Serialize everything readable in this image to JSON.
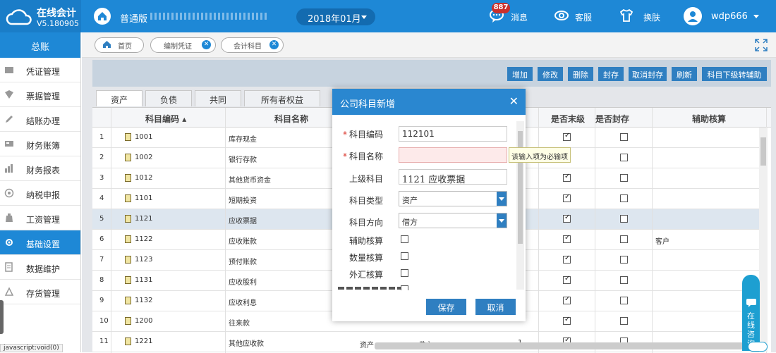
{
  "app": {
    "name": "在线会计",
    "version": "V5.180905"
  },
  "topbar": {
    "edition": "普通版",
    "period": "2018年01月",
    "messages_label": "消息",
    "messages_badge": "887",
    "service_label": "客服",
    "skin_label": "换肤",
    "username": "wdp666"
  },
  "sidebar": {
    "title": "总账",
    "items": [
      {
        "label": "凭证管理",
        "icon": "voucher-icon"
      },
      {
        "label": "票据管理",
        "icon": "invoice-icon"
      },
      {
        "label": "结账办理",
        "icon": "pencil-icon"
      },
      {
        "label": "财务账簿",
        "icon": "ledger-icon"
      },
      {
        "label": "财务报表",
        "icon": "report-chart-icon"
      },
      {
        "label": "纳税申报",
        "icon": "tax-icon"
      },
      {
        "label": "工资管理",
        "icon": "wage-icon"
      },
      {
        "label": "基础设置",
        "icon": "gear-icon"
      },
      {
        "label": "数据维护",
        "icon": "database-icon"
      },
      {
        "label": "存货管理",
        "icon": "inventory-icon"
      }
    ],
    "active": "基础设置"
  },
  "page_tabs": [
    {
      "label": "首页",
      "closable": false
    },
    {
      "label": "编制凭证",
      "closable": true
    },
    {
      "label": "会计科目",
      "closable": true
    }
  ],
  "toolbar": {
    "buttons": [
      "增加",
      "修改",
      "删除",
      "封存",
      "取消封存",
      "刷新",
      "科目下级转辅助"
    ]
  },
  "data_tabs": [
    "资产",
    "负债",
    "共同",
    "所有者权益"
  ],
  "grid": {
    "columns": {
      "code": "科目编码",
      "name": "科目名称",
      "leaf": "是否末级",
      "sealed": "是否封存",
      "aux": "辅助核算"
    },
    "rows": [
      {
        "no": "1",
        "code": "1001",
        "name": "库存现金",
        "leaf": true,
        "sealed": false,
        "aux": ""
      },
      {
        "no": "2",
        "code": "1002",
        "name": "银行存款",
        "leaf": true,
        "sealed": false,
        "aux": ""
      },
      {
        "no": "3",
        "code": "1012",
        "name": "其他货币资金",
        "leaf": true,
        "sealed": false,
        "aux": ""
      },
      {
        "no": "4",
        "code": "1101",
        "name": "短期投资",
        "leaf": true,
        "sealed": false,
        "aux": ""
      },
      {
        "no": "5",
        "code": "1121",
        "name": "应收票据",
        "leaf": true,
        "sealed": false,
        "aux": ""
      },
      {
        "no": "6",
        "code": "1122",
        "name": "应收账款",
        "leaf": true,
        "sealed": false,
        "aux": "客户"
      },
      {
        "no": "7",
        "code": "1123",
        "name": "预付账款",
        "leaf": true,
        "sealed": false,
        "aux": ""
      },
      {
        "no": "8",
        "code": "1131",
        "name": "应收股利",
        "leaf": true,
        "sealed": false,
        "aux": ""
      },
      {
        "no": "9",
        "code": "1132",
        "name": "应收利息",
        "leaf": true,
        "sealed": false,
        "aux": ""
      },
      {
        "no": "10",
        "code": "1200",
        "name": "往来款",
        "leaf": true,
        "sealed": false,
        "aux": ""
      },
      {
        "no": "11",
        "code": "1221",
        "name": "其他应收款",
        "leaf": true,
        "sealed": false,
        "aux": "",
        "type": "资产",
        "dir": "借方",
        "level": "1"
      }
    ]
  },
  "modal": {
    "title": "公司科目新增",
    "code_label": "科目编码",
    "code_value": "112101",
    "name_label": "科目名称",
    "name_value": "",
    "parent_label": "上级科目",
    "parent_value": "1121 应收票据",
    "type_label": "科目类型",
    "type_value": "资产",
    "dir_label": "科目方向",
    "dir_value": "借方",
    "aux_label": "辅助核算",
    "qty_label": "数量核算",
    "fx_label": "外汇核算",
    "save_label": "保存",
    "cancel_label": "取消",
    "tooltip": "该输入项为必输项"
  },
  "chat": {
    "label": "在线咨询"
  },
  "status": "javascript:void(0)"
}
